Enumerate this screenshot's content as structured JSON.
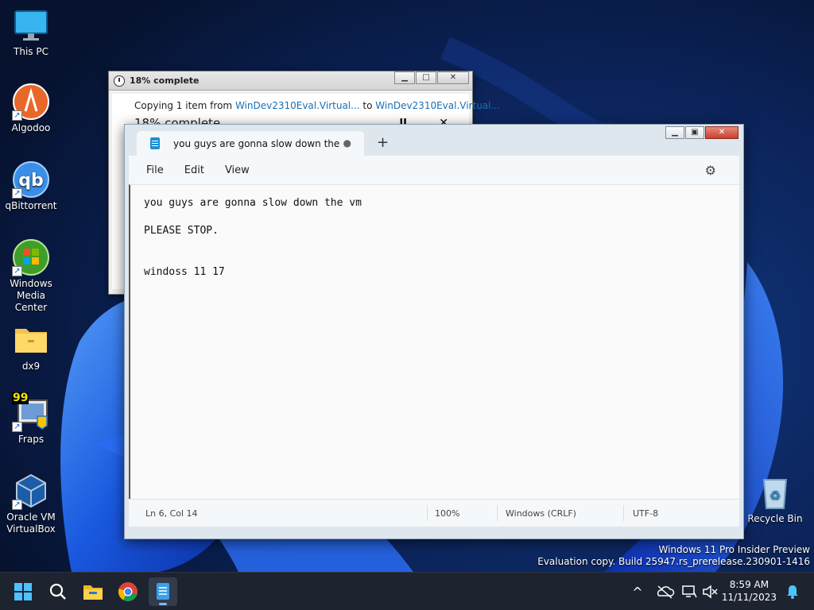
{
  "desktop": {
    "icons": [
      {
        "label": "This PC",
        "icon": "monitor-icon"
      },
      {
        "label": "Algodoo",
        "icon": "algodoo-icon"
      },
      {
        "label": "qBittorrent",
        "icon": "qbittorrent-icon"
      },
      {
        "label_line1": "Windows",
        "label_line2": "Media Center",
        "icon": "windows-media-center-icon"
      },
      {
        "label": "dx9",
        "icon": "folder-icon"
      },
      {
        "label": "Fraps",
        "icon": "fraps-icon",
        "badge": "99"
      },
      {
        "label_line1": "Oracle VM",
        "label_line2": "VirtualBox",
        "icon": "virtualbox-icon"
      },
      {
        "label": "Recycle Bin",
        "icon": "recycle-bin-icon"
      }
    ]
  },
  "copy_dialog": {
    "title": "18% complete",
    "copy_prefix": "Copying 1 item from ",
    "source": "WinDev2310Eval.Virtual...",
    "to_word": " to ",
    "destination": "WinDev2310Eval.Virtual...",
    "progress_text": "18% complete",
    "progress": 0.18,
    "pause_glyph": "II",
    "cancel_glyph": "✕",
    "min_glyph": "▁",
    "max_glyph": "□",
    "close_glyph": "✕"
  },
  "notepad": {
    "tab_title": "you guys are gonna slow down the",
    "unsaved_dot": "●",
    "new_tab_glyph": "+",
    "min_glyph": "▁",
    "max_glyph": "▣",
    "close_glyph": "✕",
    "menu": {
      "file": "File",
      "edit": "Edit",
      "view": "View"
    },
    "settings_glyph": "⚙",
    "lines": [
      "you guys are gonna slow down the vm",
      "",
      "PLEASE STOP.",
      "",
      "",
      "windoss 11 17"
    ],
    "status": {
      "position": "Ln 6, Col 14",
      "zoom": "100%",
      "line_ending": "Windows (CRLF)",
      "encoding": "UTF-8"
    }
  },
  "watermark": {
    "line1": "Windows 11 Pro Insider Preview",
    "line2": "Evaluation copy. Build 25947.rs_prerelease.230901-1416"
  },
  "taskbar": {
    "time": "8:59 AM",
    "date": "11/11/2023",
    "chevron_glyph": "^",
    "apps": [
      "start-icon",
      "search-icon",
      "file-explorer-icon",
      "chrome-icon",
      "notepad-icon"
    ]
  },
  "colors": {
    "accent": "#1b8fd2",
    "link": "#1a6fb5",
    "taskbar": "#1e2330"
  }
}
